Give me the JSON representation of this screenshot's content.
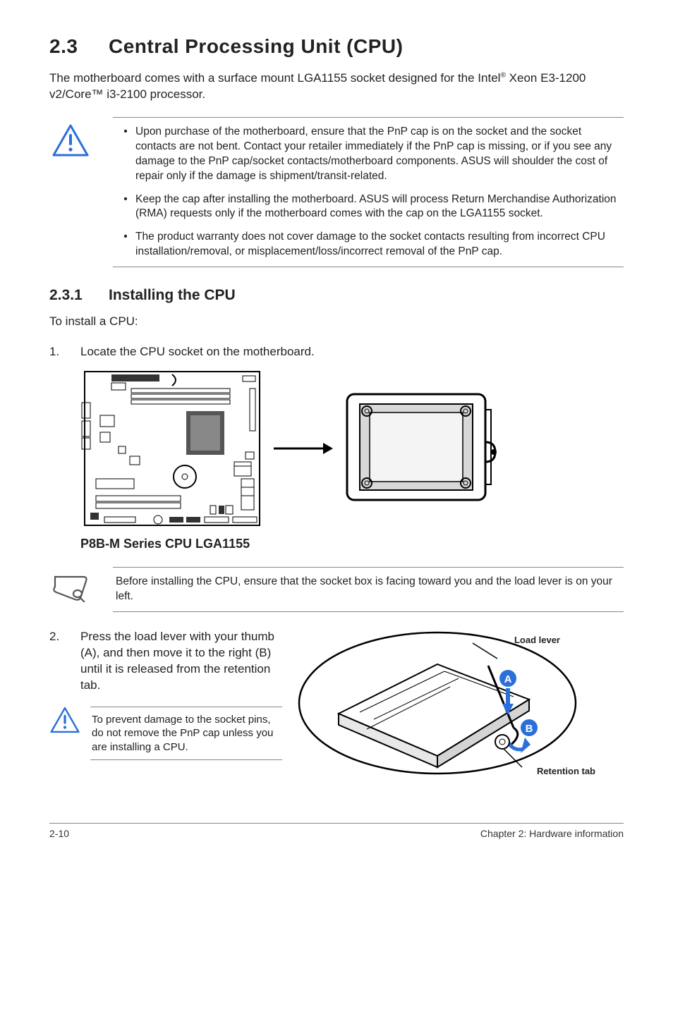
{
  "section": {
    "number": "2.3",
    "title": "Central Processing Unit (CPU)",
    "intro_pre": "The motherboard comes with a surface mount LGA1155 socket designed for the Intel",
    "intro_post": " Xeon E3-1200 v2/Core™ i3-2100 processor."
  },
  "caution_bullets": [
    "Upon purchase of the motherboard, ensure that the PnP cap is on the socket and the socket contacts are not bent. Contact your retailer immediately if the PnP cap is missing, or if you see any damage to the PnP cap/socket contacts/motherboard components. ASUS will shoulder the cost of repair only if the damage is shipment/transit-related.",
    "Keep the cap after installing the motherboard. ASUS will process Return Merchandise Authorization (RMA) requests only if the motherboard comes with the cap on the LGA1155 socket.",
    "The product warranty does not cover damage to the socket contacts resulting from incorrect CPU installation/removal, or misplacement/loss/incorrect removal of the PnP cap."
  ],
  "subsection": {
    "number": "2.3.1",
    "title": "Installing the CPU"
  },
  "install_intro": "To install a CPU:",
  "steps": {
    "1": "Locate the CPU socket on the motherboard.",
    "2": "Press the load lever with your thumb (A), and then move it to the right (B) until it is released from the retention tab."
  },
  "diagram_caption": "P8B-M Series CPU LGA1155",
  "note_text": "Before installing the CPU, ensure that the socket box is facing toward you and the load lever is on your left.",
  "inner_caution": "To prevent damage to the socket pins, do not remove the PnP cap unless you are installing a CPU.",
  "lever_labels": {
    "load_lever": "Load lever",
    "retention_tab": "Retention tab",
    "a": "A",
    "b": "B"
  },
  "footer": {
    "left": "2-10",
    "right": "Chapter 2: Hardware information"
  }
}
